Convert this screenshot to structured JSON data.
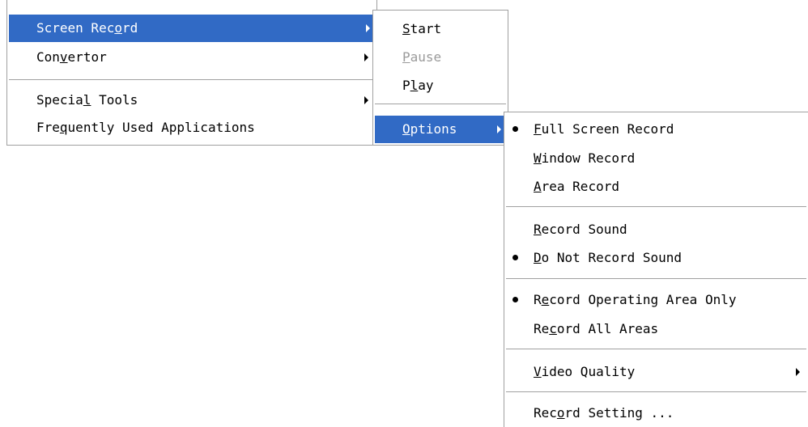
{
  "main_menu": {
    "items": [
      {
        "pre": "Screen Rec",
        "key": "o",
        "post": "rd"
      },
      {
        "pre": "Con",
        "key": "v",
        "post": "ertor"
      },
      {
        "pre": "Specia",
        "key": "l",
        "post": " Tools"
      },
      {
        "pre": "Fre",
        "key": "q",
        "post": "uently Used Applications"
      }
    ]
  },
  "record_menu": {
    "items": [
      {
        "pre": "",
        "key": "S",
        "post": "tart"
      },
      {
        "pre": "",
        "key": "P",
        "post": "ause"
      },
      {
        "pre": "P",
        "key": "l",
        "post": "ay"
      },
      {
        "pre": "",
        "key": "O",
        "post": "ptions"
      }
    ]
  },
  "options_menu": {
    "items": [
      {
        "pre": "",
        "key": "F",
        "post": "ull Screen Record"
      },
      {
        "pre": "",
        "key": "W",
        "post": "indow Record"
      },
      {
        "pre": "",
        "key": "A",
        "post": "rea Record"
      },
      {
        "pre": "",
        "key": "R",
        "post": "ecord Sound"
      },
      {
        "pre": "",
        "key": "D",
        "post": "o Not Record Sound"
      },
      {
        "pre": "R",
        "key": "e",
        "post": "cord Operating Area Only"
      },
      {
        "pre": "Re",
        "key": "c",
        "post": "ord All Areas"
      },
      {
        "pre": "",
        "key": "V",
        "post": "ideo Quality"
      },
      {
        "pre": "Rec",
        "key": "o",
        "post": "rd Setting ..."
      }
    ]
  },
  "colors": {
    "highlight": "#316ac5",
    "disabled_text": "#9a9a9a",
    "separator": "#a0a0a0"
  }
}
